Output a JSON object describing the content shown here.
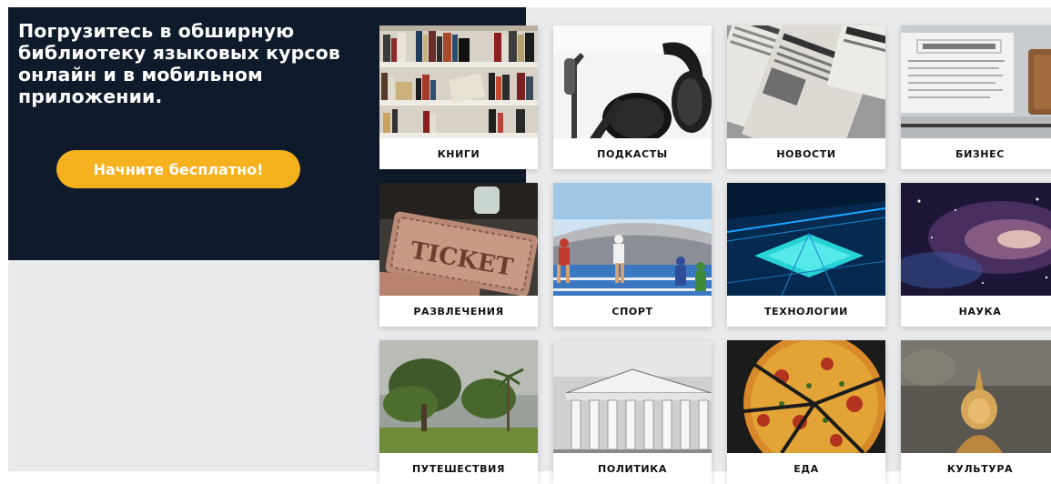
{
  "hero": {
    "title": "Погрузитесь в обширную библиотеку языковых курсов онлайн и в мобильном приложении.",
    "cta_label": "Начните бесплатно!"
  },
  "colors": {
    "hero_bg": "#0f1a2b",
    "accent": "#f6b11f",
    "page_bg": "#e9eaec"
  },
  "categories": [
    {
      "label": "КНИГИ",
      "icon": "bookshelf-icon"
    },
    {
      "label": "ПОДКАСТЫ",
      "icon": "microphone-headphones-icon"
    },
    {
      "label": "НОВОСТИ",
      "icon": "newspapers-icon"
    },
    {
      "label": "БИЗНЕС",
      "icon": "business-newspaper-icon"
    },
    {
      "label": "РАЗВЛЕЧЕНИЯ",
      "icon": "ticket-icon"
    },
    {
      "label": "СПОРТ",
      "icon": "sprinters-stadium-icon"
    },
    {
      "label": "ТЕХНОЛОГИИ",
      "icon": "tech-grid-icon"
    },
    {
      "label": "НАУКА",
      "icon": "galaxy-icon"
    },
    {
      "label": "ПУТЕШЕСТВИЯ",
      "icon": "tropical-trees-icon"
    },
    {
      "label": "ПОЛИТИКА",
      "icon": "parthenon-icon"
    },
    {
      "label": "ЕДА",
      "icon": "pizza-icon"
    },
    {
      "label": "КУЛЬТУРА",
      "icon": "buddha-statue-icon"
    }
  ]
}
